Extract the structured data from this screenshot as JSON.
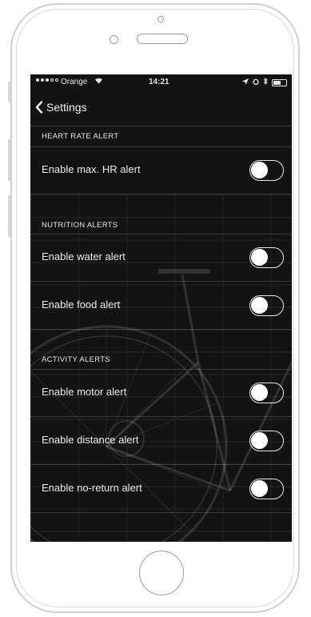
{
  "status_bar": {
    "carrier": "Orange",
    "time": "14:21"
  },
  "nav": {
    "back_label": "Settings"
  },
  "sections": [
    {
      "header": "HEART RATE ALERT",
      "rows": [
        {
          "label": "Enable max. HR alert",
          "on": false
        }
      ]
    },
    {
      "header": "NUTRITION ALERTS",
      "rows": [
        {
          "label": "Enable water alert",
          "on": false
        },
        {
          "label": "Enable food alert",
          "on": false
        }
      ]
    },
    {
      "header": "ACTIVITY ALERTS",
      "rows": [
        {
          "label": "Enable motor alert",
          "on": false
        },
        {
          "label": "Enable distance alert",
          "on": false
        },
        {
          "label": "Enable no-return alert",
          "on": false
        }
      ]
    }
  ]
}
